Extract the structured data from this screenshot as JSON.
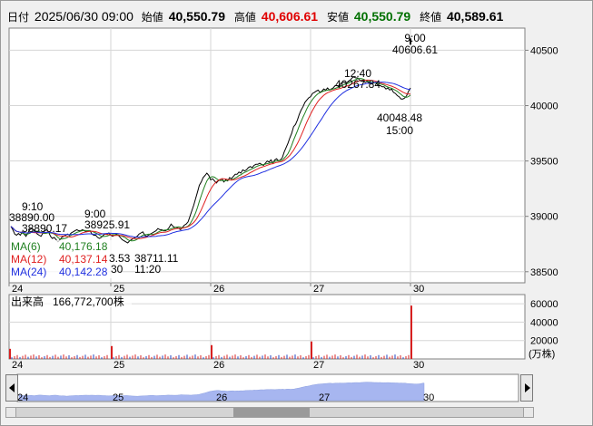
{
  "header": {
    "date_label": "日付",
    "datetime": "2025/06/30 09:00",
    "open_label": "始値",
    "open": "40,550.79",
    "high_label": "高値",
    "high": "40,606.61",
    "low_label": "安値",
    "low": "40,550.79",
    "close_label": "終値",
    "close": "40,589.61",
    "colors": {
      "high": "#e00000",
      "low": "#007000",
      "default": "#000000"
    }
  },
  "chart_data": [
    {
      "type": "line",
      "panel": "price",
      "y_range": [
        38400,
        40700
      ],
      "y_ticks": [
        "40500",
        "40000",
        "39500",
        "39000",
        "38500"
      ],
      "x_labels": [
        "24",
        "25",
        "26",
        "27",
        "30"
      ],
      "grid": true,
      "price": [
        38910,
        38880,
        38840,
        38830,
        38845,
        38830,
        38860,
        38840,
        38820,
        38850,
        38880,
        38890,
        38880,
        38860,
        38840,
        38830,
        38820,
        38850,
        38870,
        38880,
        38860,
        38820,
        38800,
        38810,
        38790,
        38770,
        38790,
        38810,
        38820,
        38830,
        38840,
        38830,
        38850,
        38860,
        38870,
        38880,
        38870,
        38870,
        38880,
        38870,
        38860,
        38870,
        38870,
        38840,
        38830,
        38830,
        38810,
        38800,
        38810,
        38830,
        38840,
        38840,
        38850,
        38830,
        38820,
        38830,
        38840,
        38830,
        38810,
        38790,
        38780,
        38770,
        38760,
        38780,
        38790,
        38800,
        38810,
        38820,
        38840,
        38850,
        38860,
        38830,
        38820,
        38830,
        38840,
        38850,
        38860,
        38870,
        38890,
        38880,
        38880,
        38870,
        38870,
        38880,
        38900,
        38930,
        38910,
        38900,
        38900,
        38890,
        38880,
        38900,
        38920,
        38930,
        38950,
        39000,
        39050,
        39100,
        39160,
        39220,
        39280,
        39310,
        39350,
        39370,
        39390,
        39370,
        39330,
        39340,
        39320,
        39300,
        39320,
        39330,
        39340,
        39310,
        39330,
        39320,
        39350,
        39340,
        39360,
        39380,
        39380,
        39400,
        39390,
        39420,
        39410,
        39420,
        39440,
        39450,
        39440,
        39460,
        39470,
        39470,
        39480,
        39470,
        39460,
        39480,
        39500,
        39490,
        39510,
        39480,
        39510,
        39520,
        39500,
        39510,
        39530,
        39580,
        39620,
        39660,
        39710,
        39750,
        39810,
        39830,
        39870,
        39920,
        39960,
        39990,
        40030,
        40050,
        40070,
        40080,
        40110,
        40120,
        40130,
        40140,
        40120,
        40130,
        40150,
        40140,
        40160,
        40140,
        40150,
        40160,
        40180,
        40180,
        40170,
        40200,
        40210,
        40210,
        40200,
        40220,
        40230,
        40250,
        40260,
        40250,
        40250,
        40230,
        40220,
        40220,
        40210,
        40220,
        40200,
        40200,
        40200,
        40210,
        40200,
        40180,
        40180,
        40170,
        40170,
        40150,
        40160,
        40140,
        40150,
        40120,
        40110,
        40090,
        40080,
        40060,
        40060,
        40070,
        40090,
        40130,
        40160
      ],
      "last_bar": {
        "x_label": "30",
        "high": 40606.61,
        "low": 40550.79,
        "close": 40589.61
      },
      "ma": [
        {
          "name": "MA(6)",
          "value": "40,176.18",
          "period": 6,
          "color": "#208020"
        },
        {
          "name": "MA(12)",
          "value": "40,137.14",
          "period": 12,
          "color": "#e02020"
        },
        {
          "name": "MA(24)",
          "value": "40,142.28",
          "period": 24,
          "color": "#2030e0"
        }
      ],
      "annotations": [
        {
          "lines": [
            "9:10",
            "38890.17"
          ],
          "value": 38890.17,
          "label_drop": [
            "38890.00"
          ]
        },
        {
          "lines": [
            "9:00",
            "38925.91"
          ],
          "value": 38925.91
        },
        {
          "lines": [
            "38711.11",
            "11:20"
          ],
          "value": 38711.11,
          "partial": [
            "3.53",
            "30"
          ]
        },
        {
          "lines": [
            "12:40",
            "40267.84"
          ],
          "value": 40267.84
        },
        {
          "lines": [
            "40048.48",
            "15:00"
          ],
          "value": 40048.48
        },
        {
          "lines": [
            "9:00",
            "40606.61"
          ],
          "value": 40606.61
        }
      ]
    },
    {
      "type": "bar",
      "panel": "volume",
      "label": "出来高",
      "total": "166,772,700株",
      "unit": "(万株)",
      "y_range": [
        0,
        70000
      ],
      "y_ticks": [
        "60000",
        "40000",
        "20000"
      ],
      "x_labels": [
        "24",
        "25",
        "26",
        "27",
        "30"
      ],
      "spikes": [
        {
          "day": "24",
          "value": 11000
        },
        {
          "day": "25",
          "value": 14000
        },
        {
          "day": "26",
          "value": 15000
        },
        {
          "day": "27",
          "value": 19000
        },
        {
          "day": "30",
          "value": 58000
        }
      ],
      "base_level": 3000,
      "colors": {
        "up": "#d82020",
        "down": "#2040c0"
      }
    },
    {
      "type": "area",
      "panel": "overview",
      "x_labels": [
        "24",
        "25",
        "26",
        "27",
        "30"
      ],
      "range": [
        38400,
        40700
      ],
      "color": "#a7b6f0"
    }
  ]
}
